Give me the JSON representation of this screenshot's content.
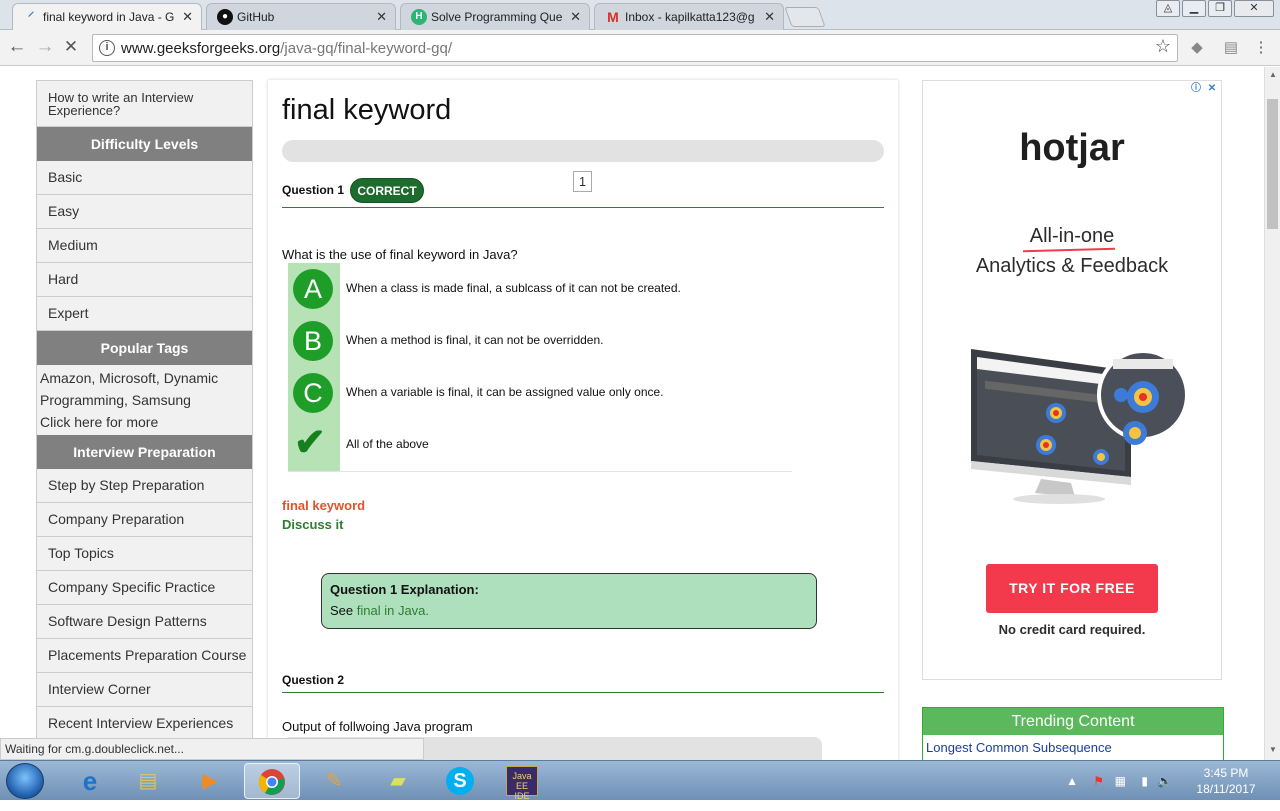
{
  "browser": {
    "tabs": [
      {
        "label": "final keyword in Java - G",
        "favicon": "loading-icon"
      },
      {
        "label": "GitHub",
        "favicon": "github-icon"
      },
      {
        "label": "Solve Programming Que",
        "favicon": "hackerearth-icon"
      },
      {
        "label": "Inbox - kapilkatta123@g",
        "favicon": "gmail-icon"
      }
    ],
    "url_domain": "www.geeksforgeeks.org",
    "url_path": "/java-gq/final-keyword-gq/",
    "status": "Waiting for cm.g.doubleclick.net..."
  },
  "sidebar": {
    "top_link": "How to write an Interview Experience?",
    "difficulty_header": "Difficulty Levels",
    "difficulty": [
      "Basic",
      "Easy",
      "Medium",
      "Hard",
      "Expert"
    ],
    "tags_header": "Popular Tags",
    "tags_text": "Amazon, Microsoft, Dynamic Programming, Samsung",
    "tags_more": "Click here for more",
    "prep_header": "Interview Preparation",
    "prep": [
      "Step by Step Preparation",
      "Company Preparation",
      "Top Topics",
      "Company Specific Practice",
      "Software Design Patterns",
      "Placements Preparation Course",
      "Interview Corner",
      "Recent Interview Experiences"
    ]
  },
  "quiz": {
    "title": "final keyword",
    "page_number": "1",
    "q1_label": "Question 1",
    "q1_result": "CORRECT",
    "q1_text": "What is the use of final keyword in Java?",
    "options": [
      {
        "letter": "A",
        "text": "When a class is made final, a sublcass of it can not be created."
      },
      {
        "letter": "B",
        "text": "When a method is final, it can not be overridden."
      },
      {
        "letter": "C",
        "text": "When a variable is final, it can be assigned value only once."
      },
      {
        "letter": "",
        "text": "All of the above"
      }
    ],
    "topic_link": "final keyword",
    "discuss_link": "Discuss it",
    "explanation_title": "Question 1 Explanation:",
    "explanation_prefix": "See",
    "explanation_link": "final in Java.",
    "q2_label": "Question 2",
    "q2_text": "Output of follwoing Java program"
  },
  "ad": {
    "brand": "hotjar",
    "tagline1": "All-in-one",
    "tagline2": "Analytics & Feedback",
    "cta": "TRY IT FOR FREE",
    "note": "No credit card required."
  },
  "trending": {
    "header": "Trending Content",
    "item": "Longest Common Subsequence"
  },
  "taskbar": {
    "time": "3:45 PM",
    "date": "18/11/2017"
  }
}
